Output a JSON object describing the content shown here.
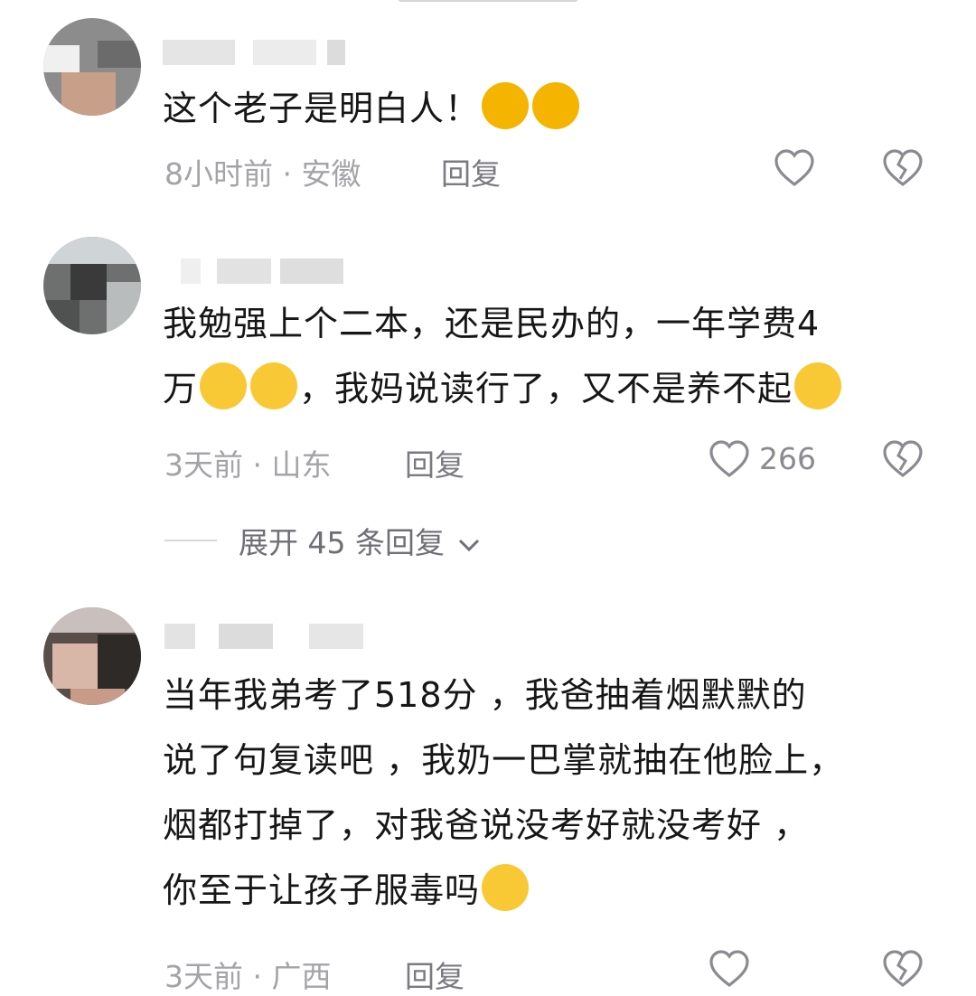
{
  "comments": [
    {
      "text": "这个老子是明白人！",
      "emojis": [
        "thumbs-up",
        "thumbs-up"
      ],
      "time": "8小时前",
      "location": "安徽",
      "reply": "回复",
      "likes": ""
    },
    {
      "line1": "我勉强上个二本，还是民办的，一年学费4",
      "line2a": "万",
      "line2b": "，我妈说读行了，又不是养不起",
      "time": "3天前",
      "location": "山东",
      "reply": "回复",
      "likes": "266",
      "expand": "展开 45 条回复"
    },
    {
      "line1": "当年我弟考了518分 ，我爸抽着烟默默的",
      "line2": "说了句复读吧 ，我奶一巴掌就抽在他脸上，",
      "line3": "烟都打掉了，对我爸说没考好就没考好 ，",
      "line4": "你至于让孩子服毒吗",
      "time": "3天前",
      "location": "广西",
      "reply": "回复",
      "likes": ""
    }
  ],
  "separator": "·",
  "colors": {
    "text": "#161616",
    "meta": "#a4a4a8",
    "reply": "#7a7a80",
    "icon": "#8a8a90"
  }
}
